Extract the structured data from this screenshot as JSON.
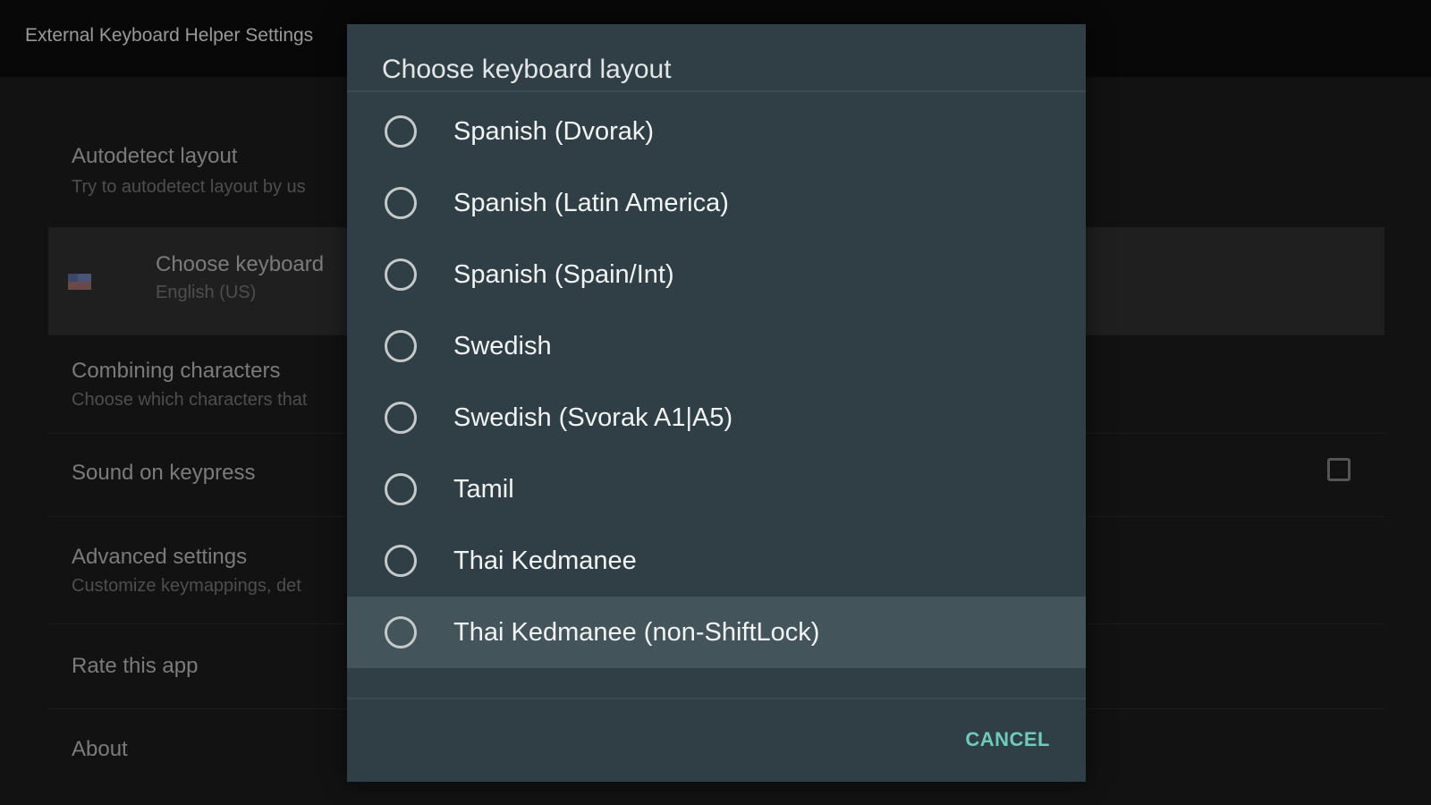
{
  "app_bar": {
    "title": "External Keyboard Helper Settings"
  },
  "settings": {
    "autodetect": {
      "title": "Autodetect layout",
      "summary": "Try to autodetect layout by us"
    },
    "choose_keyboard": {
      "title": "Choose keyboard",
      "summary": "English (US)",
      "icon": "us-flag-icon"
    },
    "combining": {
      "title": "Combining characters",
      "summary": "Choose which characters that"
    },
    "sound": {
      "title": "Sound on keypress",
      "checked": false
    },
    "advanced": {
      "title": "Advanced settings",
      "summary": "Customize keymappings, det"
    },
    "rate": {
      "title": "Rate this app"
    },
    "about": {
      "title": "About"
    }
  },
  "dialog": {
    "title": "Choose keyboard layout",
    "options": [
      {
        "label": "Spanish (Dvorak)",
        "selected": false
      },
      {
        "label": "Spanish (Latin America)",
        "selected": false
      },
      {
        "label": "Spanish (Spain/Int)",
        "selected": false
      },
      {
        "label": "Swedish",
        "selected": false
      },
      {
        "label": "Swedish (Svorak A1|A5)",
        "selected": false
      },
      {
        "label": "Tamil",
        "selected": false
      },
      {
        "label": "Thai Kedmanee",
        "selected": false
      },
      {
        "label": "Thai Kedmanee (non-ShiftLock)",
        "selected": false,
        "focused": true
      }
    ],
    "cancel_label": "CANCEL"
  },
  "colors": {
    "dialog_bg": "#2f3f45",
    "focused_row": "#43545a",
    "accent": "#6fc9bd"
  }
}
